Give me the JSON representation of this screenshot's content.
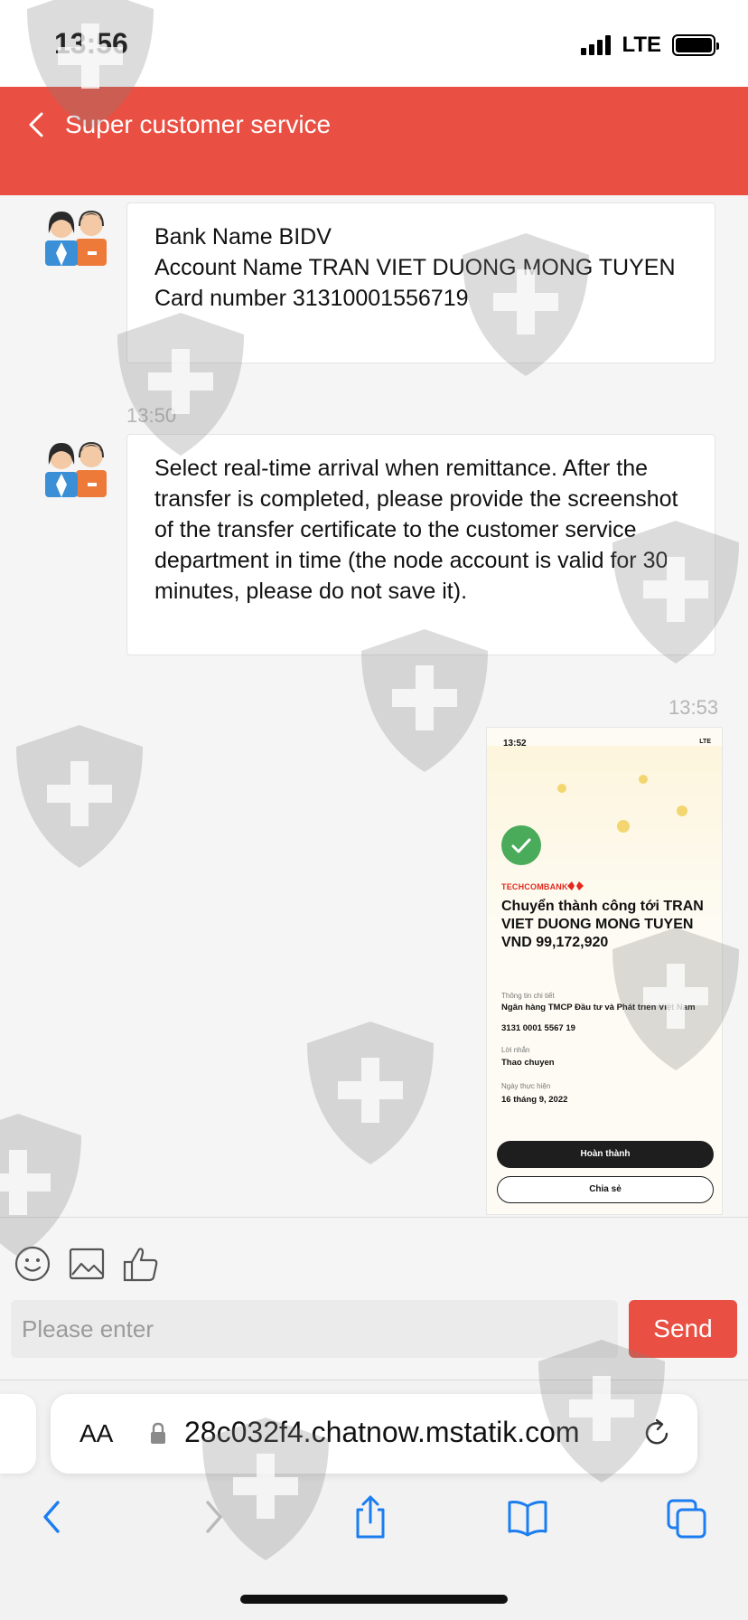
{
  "status_bar": {
    "time": "13:56",
    "network": "LTE"
  },
  "header": {
    "title": "Super customer service"
  },
  "messages": [
    {
      "lines": [
        "Bank Name BIDV",
        "Account Name TRAN VIET DUONG MONG TUYEN",
        "Card number 31310001556719"
      ]
    },
    {
      "timestamp": "13:50",
      "text": "Select real-time arrival when remittance. After the transfer is completed, please provide the screenshot of the transfer certificate to the customer service department in time (the node account is valid for 30 minutes, please do not save it)."
    },
    {
      "timestamp": "13:53"
    }
  ],
  "receipt": {
    "time": "13:52",
    "network": "LTE",
    "brand": "TECHCOMBANK",
    "headline": "Chuyển thành công tới TRAN VIET DUONG MONG TUYEN VND 99,172,920",
    "detail_label": "Thông tin chi tiết",
    "bank_name": "Ngân hàng TMCP Đầu tư và Phát triển Việt Nam",
    "account": "3131 0001 5567 19",
    "message_label": "Lời nhắn",
    "message_value": "Thao chuyen",
    "date_label": "Ngày thực hiện",
    "date_value": "16 tháng 9, 2022",
    "done_button": "Hoàn thành",
    "share_button": "Chia sẻ"
  },
  "composer": {
    "placeholder": "Please enter",
    "send_label": "Send"
  },
  "browser": {
    "text_size_label": "AA",
    "url": "28c032f4.chatnow.mstatik.com"
  },
  "colors": {
    "accent": "#e94f42",
    "success": "#4aab5a"
  }
}
